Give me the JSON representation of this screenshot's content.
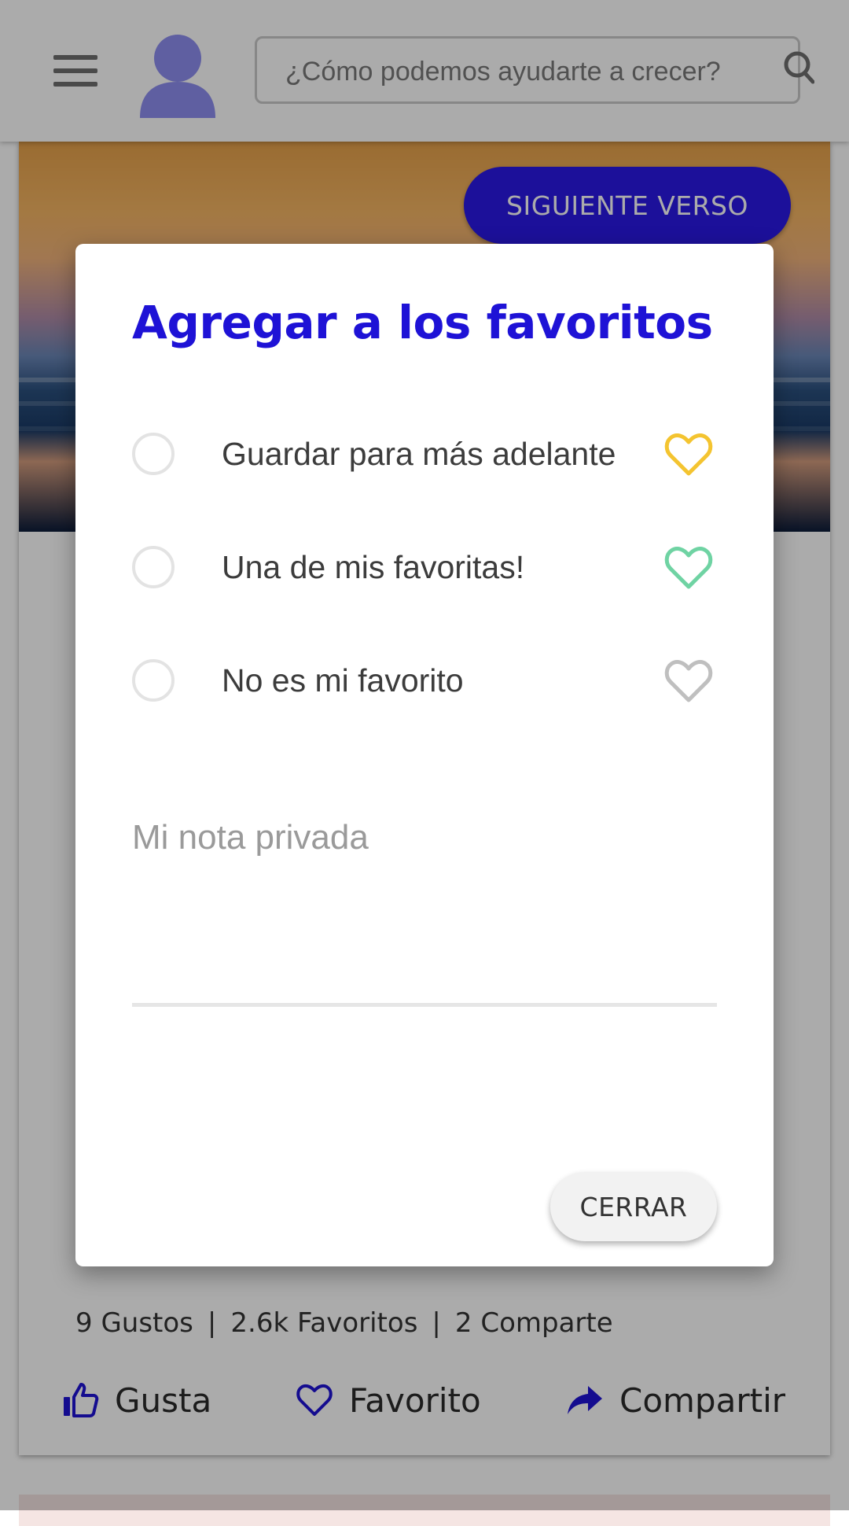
{
  "header": {
    "search": {
      "placeholder": "¿Cómo podemos ayudarte a crecer?",
      "value": ""
    },
    "icons": {
      "menu": "hamburger-icon",
      "avatar": "user-avatar",
      "search": "search-icon"
    },
    "avatar_color": "#8e8ef0"
  },
  "card": {
    "next_button_label": "SIGUIENTE VERSO",
    "next_button_color": "#2a19e6",
    "stats": {
      "likes": "9 Gustos",
      "favorites": "2.6k Favoritos",
      "shares": "2 Comparte",
      "separator": "|"
    },
    "actions": [
      {
        "label": "Gusta",
        "icon": "thumbs-up-icon"
      },
      {
        "label": "Favorito",
        "icon": "heart-outline-icon"
      },
      {
        "label": "Compartir",
        "icon": "share-arrow-icon"
      }
    ],
    "action_icon_color": "#1e12d6"
  },
  "dialog": {
    "title": "Agregar a los favoritos",
    "title_color": "#1e12d6",
    "options": [
      {
        "label": "Guardar para más adelante",
        "heart_color": "#f4c430",
        "selected": false
      },
      {
        "label": "Una de mis favoritas!",
        "heart_color": "#6fd3a3",
        "selected": false
      },
      {
        "label": "No es mi favorito",
        "heart_color": "#bfbfbf",
        "selected": false
      }
    ],
    "note": {
      "placeholder": "Mi nota privada",
      "value": ""
    },
    "close_label": "CERRAR"
  }
}
